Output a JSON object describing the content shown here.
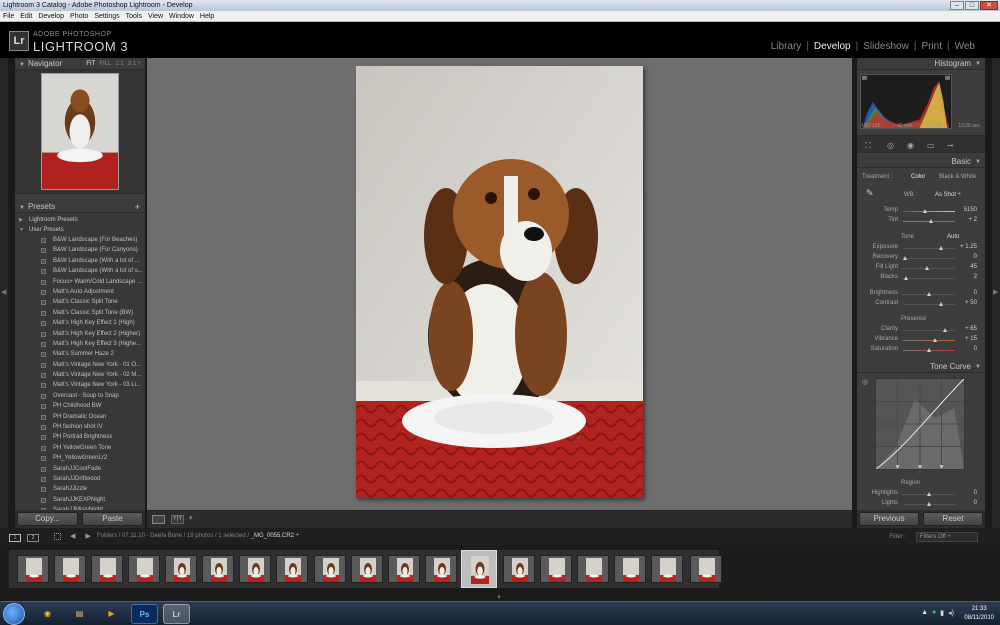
{
  "window": {
    "title": "Lightroom 3 Catalog - Adobe Photoshop Lightroom - Develop",
    "controls": [
      "–",
      "□",
      "✕"
    ]
  },
  "menu": [
    "File",
    "Edit",
    "Develop",
    "Photo",
    "Settings",
    "Tools",
    "View",
    "Window",
    "Help"
  ],
  "header": {
    "logo": "Lr",
    "subtitle": "ADOBE PHOTOSHOP",
    "app_name": "LIGHTROOM 3",
    "modules": [
      {
        "label": "Library",
        "active": false
      },
      {
        "label": "Develop",
        "active": true
      },
      {
        "label": "Slideshow",
        "active": false
      },
      {
        "label": "Print",
        "active": false
      },
      {
        "label": "Web",
        "active": false
      }
    ],
    "separator": "|"
  },
  "navigator": {
    "title": "Navigator",
    "zoom": [
      "FIT",
      "FILL",
      "1:1",
      "3:1 ÷"
    ]
  },
  "presets": {
    "title": "Presets",
    "plus": "+",
    "folders": [
      "Lightroom Presets",
      "User Presets"
    ],
    "items": [
      "B&W Landscape (For Beaches)",
      "B&W Landscape (For Canyons)",
      "B&W Landscape (With a lot of ...",
      "B&W Landscape (With a lot of s...",
      "Focus+ Warm/Cold Landscape ...",
      "Matt's Auto Adjustment",
      "Matt's Classic Split Tone",
      "Matt's Classic Split Tone (BW)",
      "Matt's High Key Effect 1 (High)",
      "Matt's High Key Effect 2 (Higher)",
      "Matt's High Key Effect 3 (Highe...",
      "Matt's Summer Haze 2",
      "Matt's Vintage New York - 01 O...",
      "Matt's Vintage New York - 02 M...",
      "Matt's Vintage New York - 03 Li...",
      "Overcast - Soup to Snap",
      "PH Childhood BW",
      "PH Dramatic Ocean",
      "PH fashion shot IV",
      "PH Portrait Brightness",
      "PH YellowGreen Tone",
      "PH_YellowGreenLr2",
      "SarahJJCoolFade",
      "SarahJJDriftwood",
      "SarahJJizzle",
      "SarahJJKEXPNight",
      "SarahJJMistyNight"
    ]
  },
  "left_buttons": {
    "copy": "Copy...",
    "paste": "Paste"
  },
  "histogram": {
    "title": "Histogram",
    "iso": "ISO 100",
    "focal": "40 mm",
    "aperture": "ƒ / 10",
    "shutter": "1/125 sec"
  },
  "basic": {
    "title": "Basic",
    "treatment_label": "Treatment :",
    "treatment_color": "Color",
    "treatment_bw": "Black & White",
    "wb_label": "WB :",
    "wb_value": "As Shot ÷",
    "temp_label": "Temp",
    "temp_value": "5150",
    "tint_label": "Tint",
    "tint_value": "+ 2",
    "tone_label": "Tone",
    "tone_auto": "Auto",
    "exposure_label": "Exposure",
    "exposure_value": "+ 1.25",
    "recovery_label": "Recovery",
    "recovery_value": "0",
    "filllight_label": "Fill Light",
    "filllight_value": "45",
    "blacks_label": "Blacks",
    "blacks_value": "2",
    "brightness_label": "Brightness",
    "brightness_value": "0",
    "contrast_label": "Contrast",
    "contrast_value": "+ 50",
    "presence_label": "Presence",
    "clarity_label": "Clarity",
    "clarity_value": "+ 65",
    "vibrance_label": "Vibrance",
    "vibrance_value": "+ 15",
    "saturation_label": "Saturation",
    "saturation_value": "0"
  },
  "tone_curve": {
    "title": "Tone Curve",
    "region_label": "Region",
    "highlights_label": "Highlights",
    "highlights_value": "0",
    "lights_label": "Lights",
    "lights_value": "0"
  },
  "right_buttons": {
    "previous": "Previous",
    "reset": "Reset"
  },
  "filmstrip_header": {
    "mon1": "1",
    "mon2": "2",
    "arrows": "◀ ▶",
    "breadcrumb": "Folders / 07.11.10 - Deefa Bone / 19 photos / 1 selected /",
    "filename": "_MG_0055.CR2 ÷",
    "filter_label": "Filter :",
    "filter_value": "Filters Off ÷"
  },
  "taskbar": {
    "ps": "Ps",
    "lr": "Lr",
    "time": "21:33",
    "date": "08/11/2010"
  },
  "colors": {
    "accent": "#d6d6d6",
    "panel": "#3d3d3d",
    "canvas": "#6e6e6e"
  }
}
